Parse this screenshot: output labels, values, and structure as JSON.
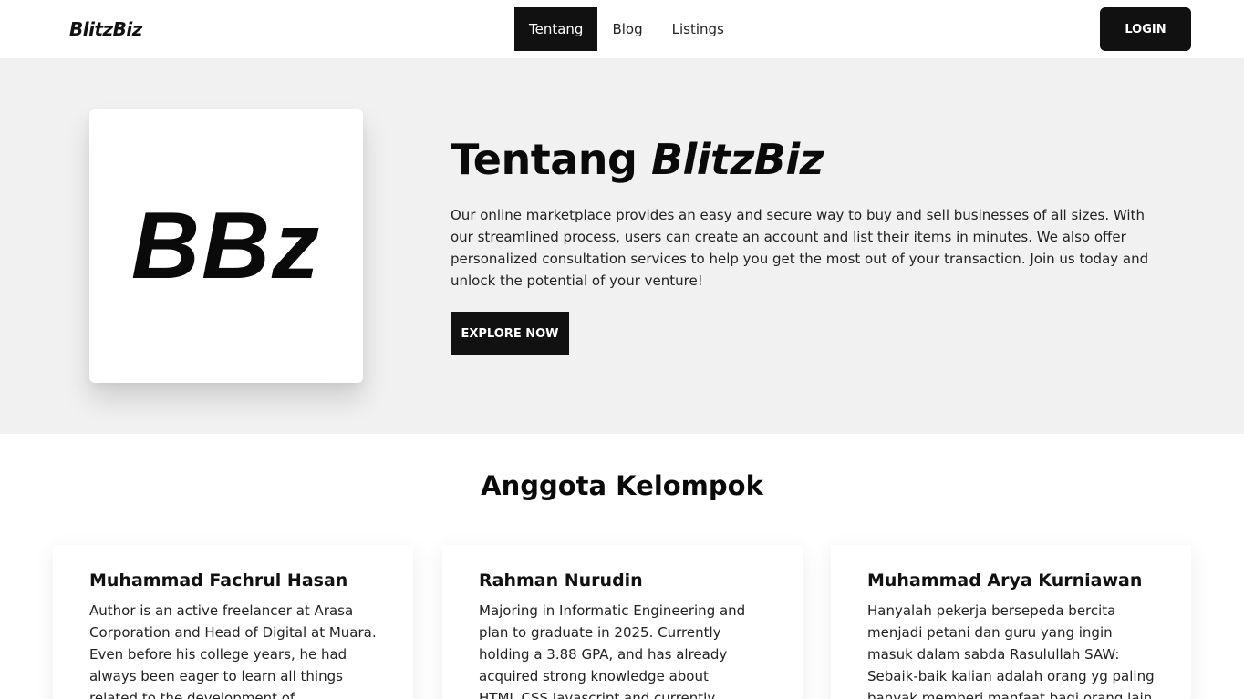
{
  "navbar": {
    "brand": "BlitzBiz",
    "links": [
      {
        "label": "Tentang",
        "active": true
      },
      {
        "label": "Blog",
        "active": false
      },
      {
        "label": "Listings",
        "active": false
      }
    ],
    "login_label": "LOGIN"
  },
  "hero": {
    "logo_text": "BBz",
    "title_prefix": "Tentang ",
    "title_brand": "BlitzBiz",
    "description": "Our online marketplace provides an easy and secure way to buy and sell businesses of all sizes. With our streamlined process, users can create an account and list their items in minutes. We also offer personalized consultation services to help you get the most out of your transaction. Join us today and unlock the potential of your venture!",
    "cta_label": "EXPLORE NOW"
  },
  "team": {
    "title": "Anggota Kelompok",
    "members": [
      {
        "name": "Muhammad Fachrul Hasan",
        "bio": "Author is an active freelancer at Arasa Corporation and Head of Digital at Muara. Even before his college years, he had always been eager to learn all things related to the development of intelligence using the"
      },
      {
        "name": "Rahman Nurudin",
        "bio": "Majoring in Informatic Engineering and plan to graduate in 2025. Currently holding a 3.88 GPA, and has already acquired strong knowledge about HTML,CSS,Javascript and currently studying ReactJS"
      },
      {
        "name": "Muhammad Arya Kurniawan",
        "bio": "Hanyalah pekerja bersepeda bercita menjadi petani dan guru yang ingin masuk dalam sabda Rasulullah SAW: Sebaik-baik kalian adalah orang yg paling banyak memberi manfaat bagi orang lain"
      }
    ]
  }
}
